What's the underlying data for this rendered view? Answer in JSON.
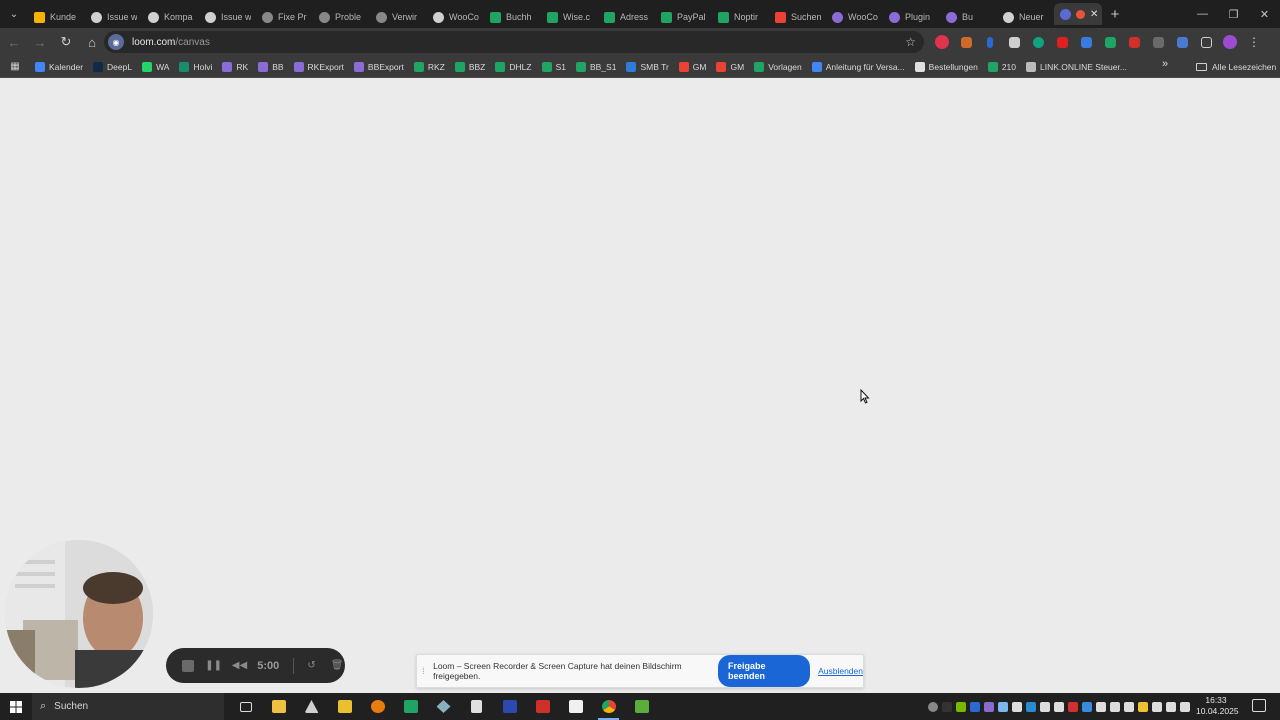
{
  "browser": {
    "tabs": [
      {
        "label": "Kunde",
        "color": "#f4b400",
        "icon": "google-sheets-icon"
      },
      {
        "label": "Issue w",
        "color": "#d0d0d0",
        "icon": "wordpress-icon"
      },
      {
        "label": "Kompa",
        "color": "#d0d0d0",
        "icon": "wordpress-icon"
      },
      {
        "label": "Issue w",
        "color": "#d0d0d0",
        "icon": "wordpress-icon"
      },
      {
        "label": "Fixe Pr",
        "color": "#888888",
        "icon": "loading-icon"
      },
      {
        "label": "Proble",
        "color": "#888888",
        "icon": "loading-icon"
      },
      {
        "label": "Verwir",
        "color": "#888888",
        "icon": "loading-icon"
      },
      {
        "label": "WooCo",
        "color": "#d0d0d0",
        "icon": "wordpress-icon"
      },
      {
        "label": "Buchh",
        "color": "#1fa463",
        "icon": "google-sheets-icon"
      },
      {
        "label": "Wise.c",
        "color": "#1fa463",
        "icon": "google-sheets-icon"
      },
      {
        "label": "Adress",
        "color": "#1fa463",
        "icon": "google-sheets-icon"
      },
      {
        "label": "PayPal",
        "color": "#1fa463",
        "icon": "google-sheets-icon"
      },
      {
        "label": "Noptir",
        "color": "#1fa463",
        "icon": "google-sheets-icon"
      },
      {
        "label": "Suchen",
        "color": "#ea4335",
        "icon": "gmail-icon"
      },
      {
        "label": "WooCo",
        "color": "#8b6bd6",
        "icon": "woocommerce-icon"
      },
      {
        "label": "Plugin",
        "color": "#8b6bd6",
        "icon": "woocommerce-icon"
      },
      {
        "label": "Bu",
        "color": "#8b6bd6",
        "icon": "woocommerce-icon"
      },
      {
        "label": "Neuer",
        "color": "#d0d0d0",
        "icon": "chrome-icon"
      }
    ],
    "url_domain": "loom.com",
    "url_path": "/canvas",
    "bookmarks": [
      {
        "label": "Kalender",
        "color": "#4285f4"
      },
      {
        "label": "DeepL",
        "color": "#0f2b46"
      },
      {
        "label": "WA",
        "color": "#25d366"
      },
      {
        "label": "Holvi",
        "color": "#1a8c6e"
      },
      {
        "label": "RK",
        "color": "#8b6bd6"
      },
      {
        "label": "BB",
        "color": "#8b6bd6"
      },
      {
        "label": "RKExport",
        "color": "#8b6bd6"
      },
      {
        "label": "BBExport",
        "color": "#8b6bd6"
      },
      {
        "label": "RKZ",
        "color": "#1fa463"
      },
      {
        "label": "BBZ",
        "color": "#1fa463"
      },
      {
        "label": "DHLZ",
        "color": "#1fa463"
      },
      {
        "label": "S1",
        "color": "#1fa463"
      },
      {
        "label": "BB_S1",
        "color": "#1fa463"
      },
      {
        "label": "SMB Tr",
        "color": "#2f7bd8"
      },
      {
        "label": "GM",
        "color": "#ea4335"
      },
      {
        "label": "GM",
        "color": "#ea4335"
      },
      {
        "label": "Vorlagen",
        "color": "#1fa463"
      },
      {
        "label": "Anleitung für Versa...",
        "color": "#4285f4"
      },
      {
        "label": "Bestellungen",
        "color": "#e0e0e0"
      },
      {
        "label": "210",
        "color": "#1fa463"
      },
      {
        "label": "LINK.ONLINE Steuer...",
        "color": "#bbbbbb"
      }
    ],
    "all_bookmarks": "Alle Lesezeichen"
  },
  "recorder": {
    "time": "5:00"
  },
  "share_bar": {
    "message": "Loom – Screen Recorder & Screen Capture hat deinen Bildschirm freigegeben.",
    "stop_label": "Freigabe beenden",
    "hide_label": "Ausblenden"
  },
  "taskbar": {
    "search_label": "Suchen",
    "time": "16:33",
    "date": "10.04.2025"
  }
}
